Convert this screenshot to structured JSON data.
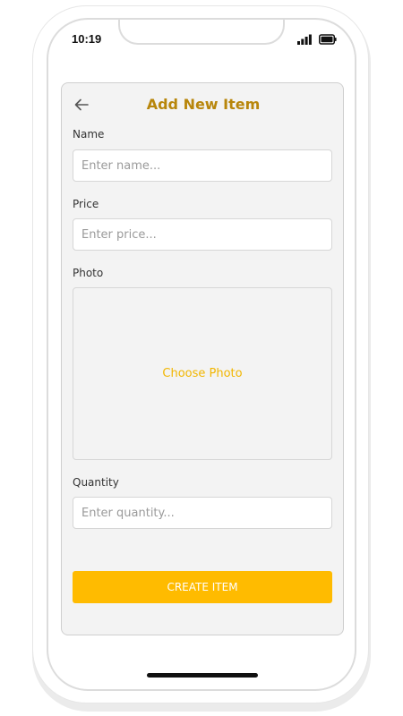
{
  "status_bar": {
    "time": "10:19",
    "signal_icon": "signal-bars-icon",
    "battery_icon": "battery-icon"
  },
  "header": {
    "back_icon": "arrow-left-icon",
    "title": "Add New Item"
  },
  "form": {
    "name": {
      "label": "Name",
      "placeholder": "Enter name...",
      "value": ""
    },
    "price": {
      "label": "Price",
      "placeholder": "Enter price...",
      "value": ""
    },
    "photo": {
      "label": "Photo",
      "action_text": "Choose Photo"
    },
    "quantity": {
      "label": "Quantity",
      "placeholder": "Enter quantity...",
      "value": ""
    },
    "submit_label": "CREATE ITEM"
  },
  "colors": {
    "title": "#b8860b",
    "accent": "#ffbb00",
    "photo_link": "#f2b600",
    "card_background": "#f3f3f3"
  }
}
